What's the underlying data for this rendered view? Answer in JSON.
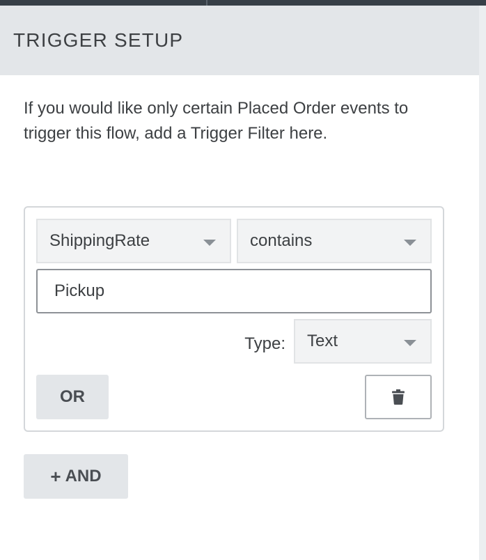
{
  "panel": {
    "title": "TRIGGER SETUP",
    "description": "If you would like only certain Placed Order events to trigger this flow, add a Trigger Filter here."
  },
  "filter": {
    "field_select": {
      "value": "ShippingRate",
      "icon": "chevron-down-icon"
    },
    "operator_select": {
      "value": "contains",
      "icon": "chevron-down-icon"
    },
    "value_input": {
      "value": "Pickup"
    },
    "type_label": "Type:",
    "type_select": {
      "value": "Text",
      "icon": "chevron-down-icon"
    },
    "or_button": "OR",
    "delete_icon": "trash-icon"
  },
  "and_button": {
    "plus": "+",
    "label": "AND"
  },
  "colors": {
    "header_bg": "#e3e6e9",
    "topbar": "#373f47",
    "select_bg": "#f2f3f4",
    "button_bg": "#e3e6e9"
  }
}
